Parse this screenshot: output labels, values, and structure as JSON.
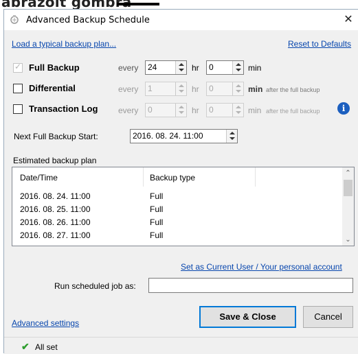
{
  "background_text": "abrázolt gombra",
  "window": {
    "title": "Advanced Backup Schedule",
    "close_glyph": "✕"
  },
  "links": {
    "load_typical": "Load a typical backup plan...",
    "reset_defaults": "Reset to Defaults",
    "set_current_user": "Set as Current User / Your personal account",
    "advanced_settings": "Advanced settings"
  },
  "full_backup": {
    "label": "Full Backup",
    "every": "every",
    "hours": "24",
    "hr": "hr",
    "minutes": "0",
    "min": "min"
  },
  "differential": {
    "label": "Differential",
    "every": "every",
    "hours": "1",
    "hr": "hr",
    "minutes": "0",
    "min": "min",
    "note": "after the full backup"
  },
  "transaction_log": {
    "label": "Transaction Log",
    "every": "every",
    "hours": "0",
    "hr": "hr",
    "minutes": "0",
    "min": "min",
    "note": "after the full backup"
  },
  "next_full": {
    "label": "Next Full Backup Start:",
    "value": "2016. 08. 24. 11:00"
  },
  "estimated": {
    "label": "Estimated backup plan",
    "columns": [
      "Date/Time",
      "Backup type"
    ],
    "rows": [
      {
        "date": "2016. 08. 24. 11:00",
        "type": "Full"
      },
      {
        "date": "2016. 08. 25. 11:00",
        "type": "Full"
      },
      {
        "date": "2016. 08. 26. 11:00",
        "type": "Full"
      },
      {
        "date": "2016. 08. 27. 11:00",
        "type": "Full"
      }
    ]
  },
  "run_as": {
    "label": "Run scheduled job as:",
    "value": ""
  },
  "buttons": {
    "save_close": "Save & Close",
    "cancel": "Cancel"
  },
  "status": {
    "text": "All set"
  },
  "colors": {
    "link": "#0645ad",
    "accent": "#0078d7",
    "status_ok": "#2e9d2e",
    "info": "#1c5fbf"
  }
}
